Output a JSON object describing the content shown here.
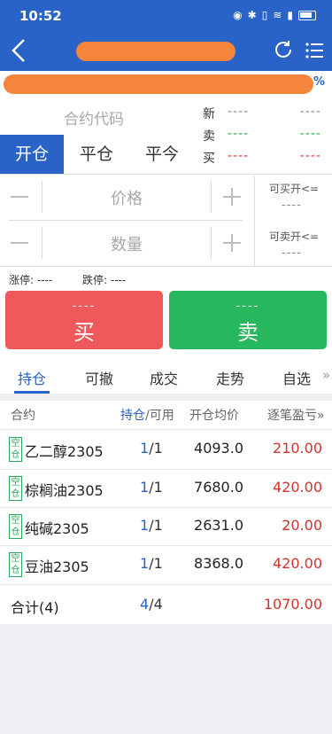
{
  "status": {
    "time": "10:52"
  },
  "header": {
    "title": "",
    "subtitle_suffix": "%"
  },
  "contract": {
    "placeholder": "合约代码"
  },
  "quotes": [
    {
      "label": "新",
      "v1": "----",
      "v2": "----"
    },
    {
      "label": "卖",
      "v1": "----",
      "v2": "----"
    },
    {
      "label": "买",
      "v1": "----",
      "v2": "----"
    }
  ],
  "order_tabs": [
    "开仓",
    "平仓",
    "平今"
  ],
  "price": {
    "placeholder": "价格"
  },
  "qty": {
    "placeholder": "数量"
  },
  "side": {
    "can_buy_label": "可买开<=",
    "can_buy_value": "----",
    "can_sell_label": "可卖开<=",
    "can_sell_value": "----"
  },
  "limits": {
    "up": "涨停: ----",
    "down": "跌停: ----"
  },
  "buy": {
    "dash": "----",
    "label": "买"
  },
  "sell": {
    "dash": "----",
    "label": "卖"
  },
  "list_tabs": [
    "持仓",
    "可撤",
    "成交",
    "走势",
    "自选"
  ],
  "list_more": "»",
  "table": {
    "col_contract": "合约",
    "col_hold": "持仓",
    "col_avail": "/可用",
    "col_avg": "开仓均价",
    "col_pnl": "逐笔盈亏»",
    "rows": [
      {
        "tag": "空仓",
        "name": "乙二醇2305",
        "hold": "1",
        "avail": "/1",
        "avg": "4093.0",
        "pnl": "210.00"
      },
      {
        "tag": "空仓",
        "name": "棕榈油2305",
        "hold": "1",
        "avail": "/1",
        "avg": "7680.0",
        "pnl": "420.00"
      },
      {
        "tag": "空仓",
        "name": "纯碱2305",
        "hold": "1",
        "avail": "/1",
        "avg": "2631.0",
        "pnl": "20.00"
      },
      {
        "tag": "空仓",
        "name": "豆油2305",
        "hold": "1",
        "avail": "/1",
        "avg": "8368.0",
        "pnl": "420.00"
      }
    ],
    "total": {
      "name": "合计(4)",
      "hold": "4",
      "avail": "/4",
      "pnl": "1070.00"
    }
  },
  "colors": {
    "primary": "#2a63c8",
    "buy": "#f0595b",
    "sell": "#27b75c",
    "profit": "#d0342c",
    "redacted": "#f5853a"
  }
}
